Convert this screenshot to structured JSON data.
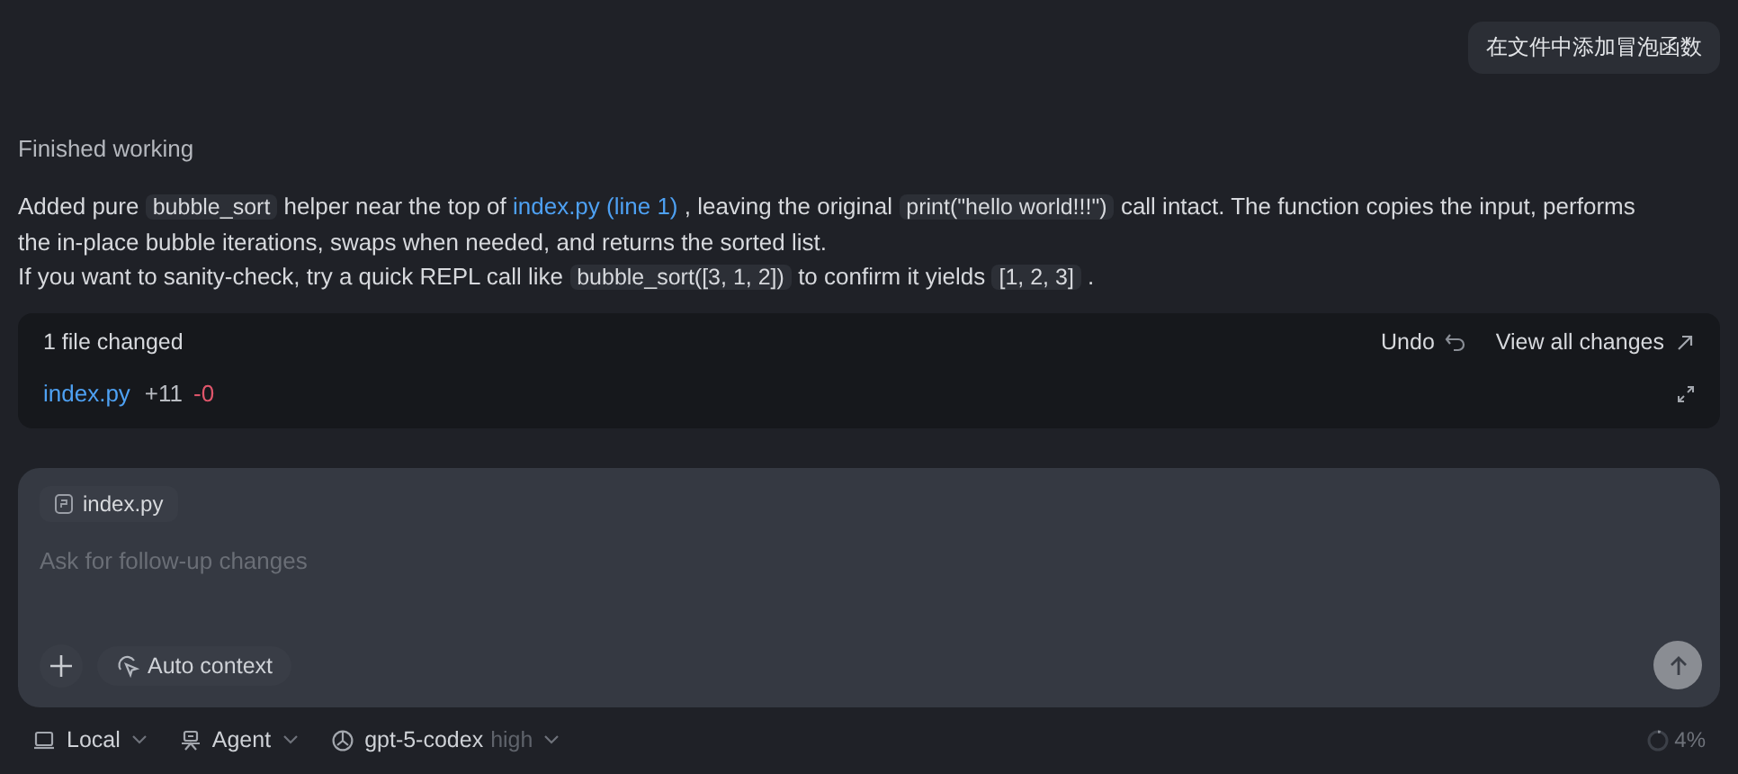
{
  "user_message": "在文件中添加冒泡函数",
  "status": "Finished working",
  "paragraphs": [
    [
      {
        "kind": "text",
        "text": "Added pure "
      },
      {
        "kind": "code",
        "text": "bubble_sort"
      },
      {
        "kind": "text",
        "text": " helper near the top of "
      },
      {
        "kind": "link",
        "text": "index.py (line 1)"
      },
      {
        "kind": "text",
        "text": " , leaving the original "
      },
      {
        "kind": "code",
        "text": "print(\"hello world!!!\")"
      },
      {
        "kind": "text",
        "text": " call intact. The function copies the input, performs the in-place bubble iterations, swaps when needed, and returns the sorted list."
      }
    ],
    [
      {
        "kind": "text",
        "text": "If you want to sanity-check, try a quick REPL call like "
      },
      {
        "kind": "code",
        "text": "bubble_sort([3, 1, 2])"
      },
      {
        "kind": "text",
        "text": " to confirm it yields "
      },
      {
        "kind": "code",
        "text": "[1, 2, 3]"
      },
      {
        "kind": "text",
        "text": " ."
      }
    ]
  ],
  "changes": {
    "title": "1 file changed",
    "undo": "Undo",
    "view_all": "View all changes",
    "files": [
      {
        "name": "index.py",
        "added": "+11",
        "removed": "-0"
      }
    ]
  },
  "composer": {
    "attachment": "index.py",
    "placeholder": "Ask for follow-up changes",
    "context_button": "Auto context"
  },
  "bottom_bar": {
    "location": "Local",
    "mode": "Agent",
    "model": "gpt-5-codex",
    "effort": "high",
    "context": {
      "reading": "4%"
    }
  }
}
